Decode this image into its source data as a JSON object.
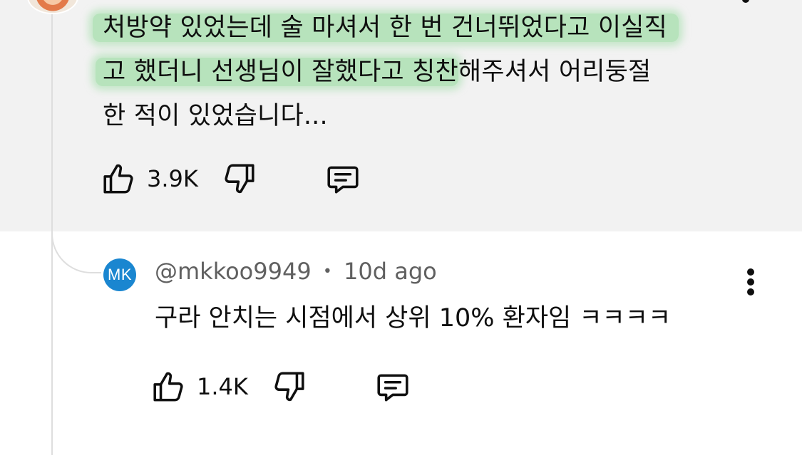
{
  "parent_comment": {
    "text_lines": [
      {
        "highlighted": "처방약 있었는데 술 마셔서 한 번 건너뛰었다고 이실직",
        "plain": ""
      },
      {
        "highlighted": "고 했더니 선생님이 잘했다고 칭찬",
        "plain": "해주셔서 어리둥절"
      },
      {
        "highlighted": "",
        "plain": "한 적이 있었습니다..."
      }
    ],
    "like_count": "3.9K",
    "highlight_color": "#a3deaa"
  },
  "reply": {
    "avatar_initials": "MK",
    "avatar_color": "#1a86d0",
    "author": "@mkkoo9949",
    "separator": "•",
    "time": "10d ago",
    "text": "구라 안치는 시점에서 상위 10% 환자임 ㅋㅋㅋㅋ",
    "like_count": "1.4K"
  },
  "icons": {
    "like": "thumbs-up-icon",
    "dislike": "thumbs-down-icon",
    "reply": "reply-comment-icon",
    "more": "more-vert-icon"
  }
}
